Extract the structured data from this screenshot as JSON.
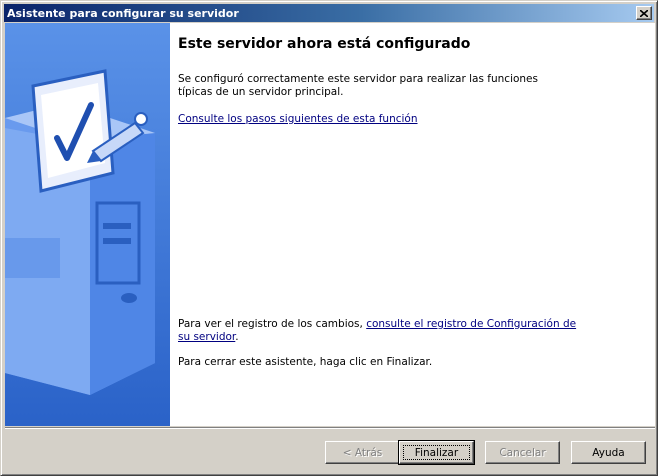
{
  "window": {
    "title": "Asistente para configurar su servidor",
    "close_icon": "close-icon"
  },
  "main": {
    "heading": "Este servidor ahora está configurado",
    "description": "Se configuró correctamente este servidor para realizar las funciones típicas de un servidor principal.",
    "next_steps_link": "Consulte los pasos siguientes de esta función",
    "log_prefix": "Para ver el registro de los cambios, ",
    "log_link": "consulte el registro de Configuración de su servidor",
    "log_suffix": ".",
    "close_instruction": "Para cerrar este asistente, haga clic en Finalizar."
  },
  "buttons": {
    "back": "< Atrás",
    "finish": "Finalizar",
    "cancel": "Cancelar",
    "help": "Ayuda"
  },
  "colors": {
    "side_panel": "#3170d4",
    "title_bar": "#0a246a",
    "link": "#000080"
  },
  "illustration": "server-checklist-illustration"
}
